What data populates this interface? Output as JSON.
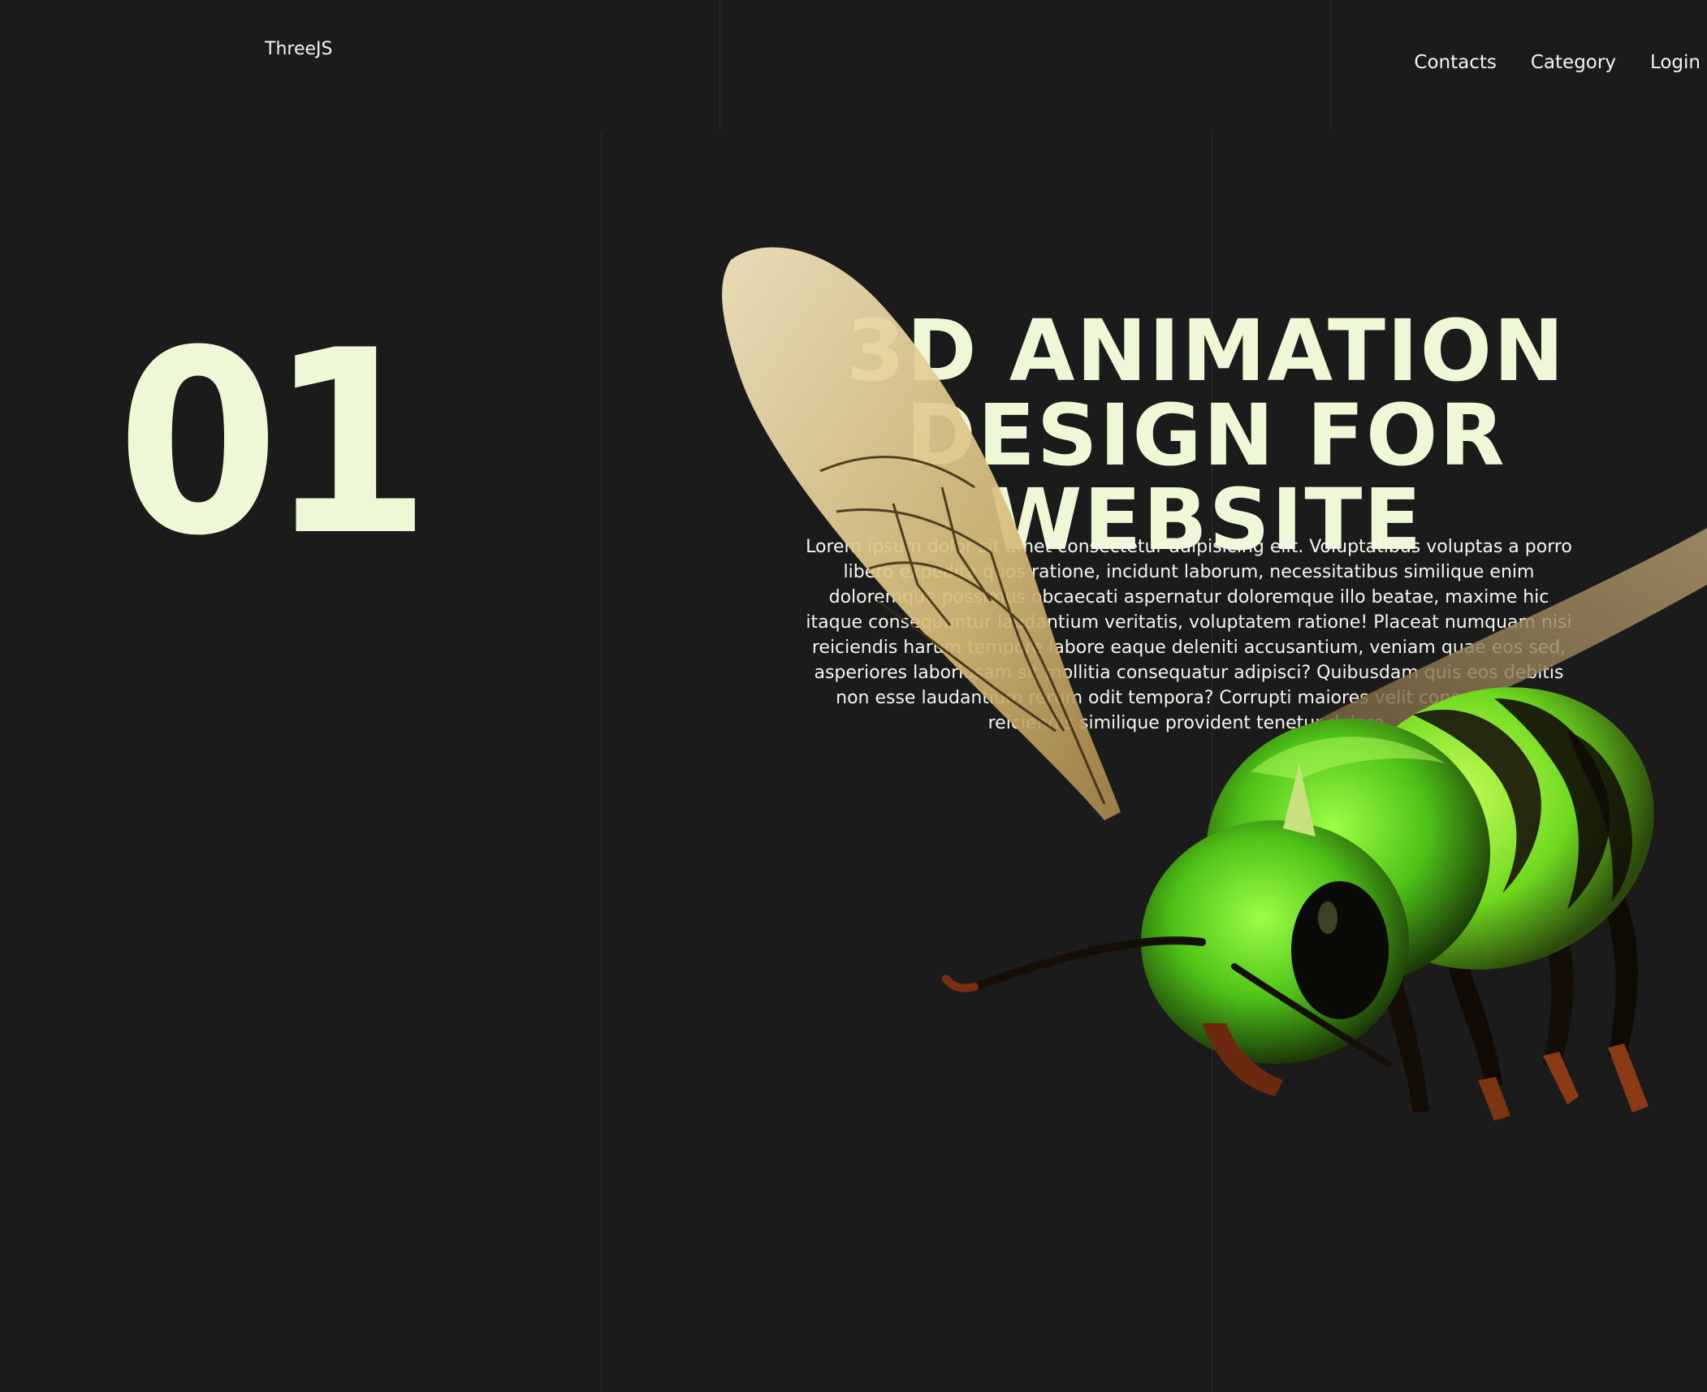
{
  "header": {
    "brand": "ThreeJS",
    "nav": [
      "Contacts",
      "Category",
      "Login"
    ]
  },
  "hero": {
    "number": "01",
    "headline": [
      "3D ANIMATION",
      "DESIGN FOR",
      "WEBSITE"
    ],
    "paragraph": "Lorem ipsum dolor sit amet consectetur adipisicing elit. Voluptatibus voluptas a porro libero expedita quos ratione, incidunt laborum, necessitatibus similique enim doloremque possimus obcaecati aspernatur doloremque illo beatae, maxime hic itaque consequuntur laudantium veritatis, voluptatem ratione! Placeat numquam nisi reiciendis harum tempore labore eaque deleniti accusantium, veniam quae eos sed, asperiores laboriosam sit mollitia consequatur adipisci? Quibusdam quis eos debitis non esse laudantium rerum odit tempora? Corrupti maiores velit consequuntur reiciendis similique provident tenetur dolore."
  },
  "colors": {
    "background": "#1b1b1b",
    "accent": "#eef7d6",
    "bee_green": "#6fe02a",
    "bee_dark": "#1a140c",
    "wing": "#e9d6a3"
  }
}
